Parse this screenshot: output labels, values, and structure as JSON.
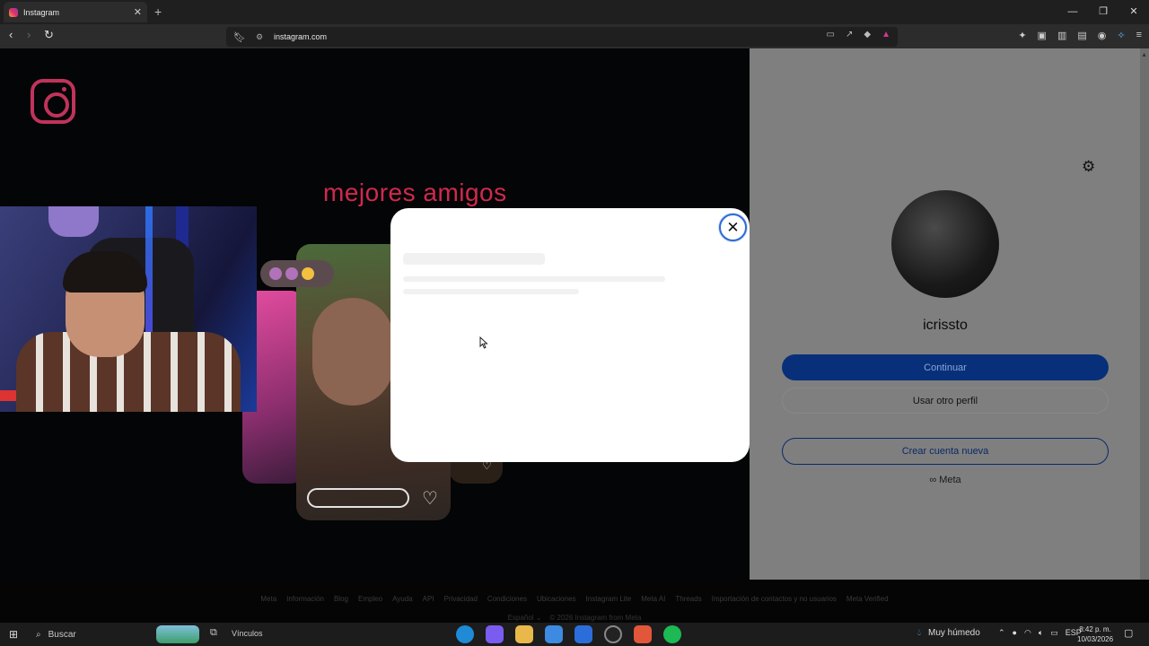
{
  "browser": {
    "tab_title": "Instagram",
    "tab_close": "✕",
    "new_tab": "+",
    "url": "instagram.com",
    "window_controls": [
      "—",
      "❐",
      "✕"
    ]
  },
  "instagram_left": {
    "headline": "mejores amigos"
  },
  "account_panel": {
    "username": "icrissto",
    "continue_label": "Continuar",
    "other_profile_label": "Usar otro perfil",
    "create_account_label": "Crear cuenta nueva",
    "meta_label": "∞ Meta"
  },
  "modal": {
    "close_glyph": "✕"
  },
  "footer": {
    "links": [
      "Meta",
      "Información",
      "Blog",
      "Empleo",
      "Ayuda",
      "API",
      "Privacidad",
      "Condiciones",
      "Ubicaciones",
      "Instagram Lite",
      "Meta AI",
      "Threads",
      "Importación de contactos y no usuarios",
      "Meta Verified"
    ],
    "language": "Español ⌄",
    "copyright": "© 2026 Instagram from Meta"
  },
  "taskbar": {
    "search_label": "Buscar",
    "vinculos_label": "Vínculos",
    "weather": "Muy húmedo",
    "language": "ESP",
    "time": "8:42 p. m.",
    "date": "10/03/2026"
  },
  "colors": {
    "primary_button": "#08307a",
    "instagram_brand": "#c0335c",
    "close_ring": "#2d6ad6"
  }
}
